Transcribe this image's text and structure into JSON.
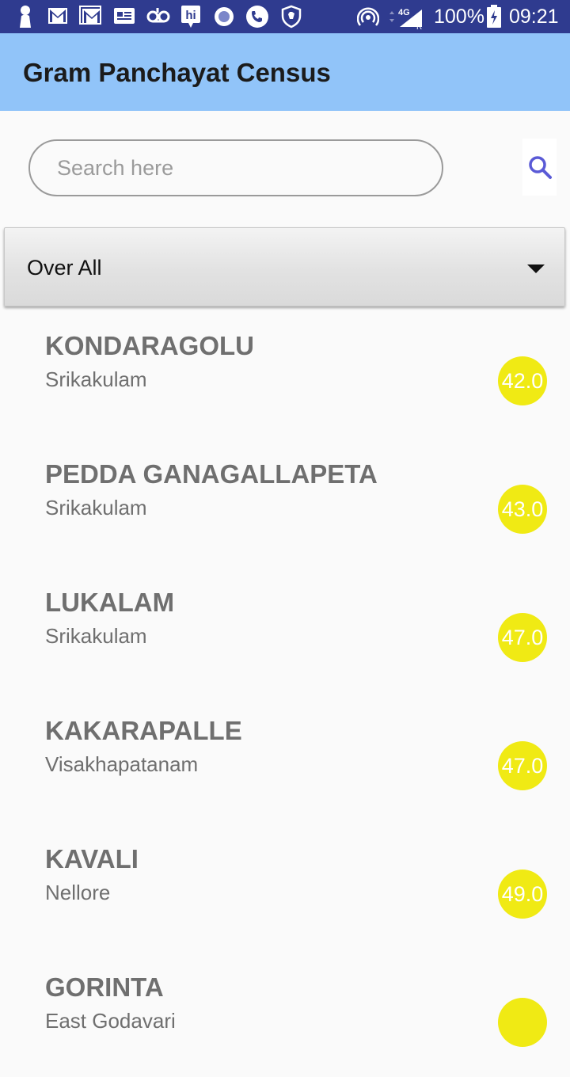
{
  "status_bar": {
    "battery": "100%",
    "time": "09:21",
    "network": "4G"
  },
  "app_bar": {
    "title": "Gram Panchayat Census"
  },
  "search": {
    "placeholder": "Search here",
    "value": ""
  },
  "filter": {
    "selected": "Over All"
  },
  "list": [
    {
      "name": "KONDARAGOLU",
      "district": "Srikakulam",
      "score": "42.0"
    },
    {
      "name": "PEDDA GANAGALLAPETA",
      "district": "Srikakulam",
      "score": "43.0"
    },
    {
      "name": "LUKALAM",
      "district": "Srikakulam",
      "score": "47.0"
    },
    {
      "name": "KAKARAPALLE",
      "district": "Visakhapatanam",
      "score": "47.0"
    },
    {
      "name": "KAVALI",
      "district": "Nellore",
      "score": "49.0"
    },
    {
      "name": "GORINTA",
      "district": "East Godavari",
      "score": ""
    }
  ],
  "colors": {
    "status_bar": "#2f3b8f",
    "app_bar": "#91c4f9",
    "score_badge": "#f0ea14",
    "search_icon": "#5a5ad6"
  },
  "icons": [
    "person-icon",
    "gmail-icon",
    "gmail-icon",
    "news-icon",
    "voicemail-icon",
    "hi-icon",
    "record-icon",
    "phone-icon",
    "shield-icon",
    "hotspot-icon",
    "signal-icon",
    "battery-icon",
    "search-icon",
    "dropdown-arrow-icon"
  ]
}
